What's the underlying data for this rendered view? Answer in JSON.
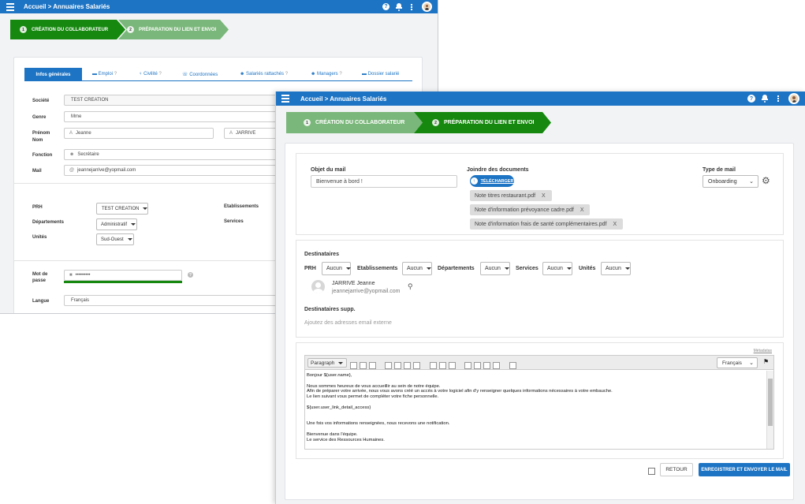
{
  "win1": {
    "header": {
      "title": "Accueil > Annuaires Salariés",
      "help_icon": "?"
    },
    "steps": [
      {
        "num": "1",
        "label": "CRÉATION DU COLLABORATEUR"
      },
      {
        "num": "2",
        "label": "PRÉPARATION DU LIEN ET ENVOI"
      }
    ],
    "tabs": [
      {
        "label": "Infos générales"
      },
      {
        "label": "Emploi",
        "icon": "briefcase-icon",
        "glyph": "▬"
      },
      {
        "label": "Civilité",
        "icon": "person-icon",
        "glyph": "♀"
      },
      {
        "label": "Coordonnées",
        "icon": "phone-icon",
        "glyph": "☏"
      },
      {
        "label": "Salariés rattachés",
        "icon": "group-icon",
        "glyph": "☻"
      },
      {
        "label": "Managers",
        "icon": "user-icon",
        "glyph": "☻"
      },
      {
        "label": "Dossier salarié",
        "icon": "folder-icon",
        "glyph": "▬"
      }
    ],
    "tab_help_icon": "?",
    "form": {
      "societe_label": "Société",
      "societe_value": "TEST CREATION",
      "genre_label": "Genre",
      "genre_value": "Mme",
      "prenom_label": "Prénom",
      "nom_label": "Nom",
      "prenom_value": "Jeanne",
      "nom_value": "JARRIVE",
      "fonction_label": "Fonction",
      "fonction_value": "Secrétaire",
      "mail_label": "Mail",
      "mail_value": "jeannejarrive@yopmail.com",
      "prh_label": "PRH",
      "prh_value": "TEST CREATION",
      "departements_label": "Départements",
      "departements_value": "Administratif",
      "unites_label": "Unités",
      "unites_value": "Sud-Ouest",
      "etablissements_label": "Etablissements",
      "services_label": "Services",
      "mdp_label_1": "Mot de",
      "mdp_label_2": "passe",
      "mdp_value": "•••••••••",
      "mdp_help": "?",
      "langue_label": "Langue",
      "langue_value": "Français"
    }
  },
  "win2": {
    "header": {
      "title": "Accueil > Annuaires Salariés",
      "help_icon": "?"
    },
    "steps": [
      {
        "num": "1",
        "label": "CRÉATION DU COLLABORATEUR"
      },
      {
        "num": "2",
        "label": "PRÉPARATION DU LIEN ET ENVOI"
      }
    ],
    "mail": {
      "objet_label": "Objet du mail",
      "objet_value": "Bienvenue à bord !",
      "joindre_label": "Joindre des documents",
      "upload_label": "TÉLÉCHARGER",
      "attachments": [
        "Note titres restaurant.pdf",
        "Note d'information prévoyance cadre.pdf",
        "Note d'information frais de santé complémentaires.pdf"
      ],
      "remove_glyph": "X",
      "type_label": "Type de mail",
      "type_value": "Onboarding"
    },
    "dest": {
      "title": "Destinataires",
      "filters": [
        {
          "label": "PRH",
          "value": "Aucun"
        },
        {
          "label": "Etablissements",
          "value": "Aucun"
        },
        {
          "label": "Départements",
          "value": "Aucun"
        },
        {
          "label": "Services",
          "value": "Aucun"
        },
        {
          "label": "Unités",
          "value": "Aucun"
        }
      ],
      "recipient_name": "JARRIVE Jeanne",
      "recipient_email": "jeannejarrive@yopmail.com",
      "supp_label": "Destinataires supp.",
      "supp_placeholder": "Ajoutez des adresses email externe"
    },
    "editor": {
      "metadata_link": "Métadatas",
      "format_value": "Paragraph",
      "lang_value": "Français",
      "body": [
        "Bonjour ${user.name},",
        "",
        "Nous sommes heureux de vous accueillir au sein de notre équipe.",
        "Afin de préparer votre arrivée, nous vous avons créé un accès à votre logiciel afin d'y renseigner quelques informations nécessaires à votre embauche.",
        "Le lien suivant vous permet de compléter votre fiche personnelle.",
        "",
        "${user.user_link_detail_access}",
        "",
        "",
        "Une fois vos informations renseignées, nous recevons une notification.",
        "",
        "Bienvenue dans l'équipe.",
        "Le service des Ressources Humaines."
      ]
    },
    "actions": {
      "retour_label": "RETOUR",
      "submit_label": "ENREGISTRER ET ENVOYER LE MAIL"
    }
  },
  "colors": {
    "header_blue": "#1d74c4",
    "step_done_green": "#7ab77a",
    "step_active_green": "#16880f",
    "primary_button": "#1d74c4"
  }
}
